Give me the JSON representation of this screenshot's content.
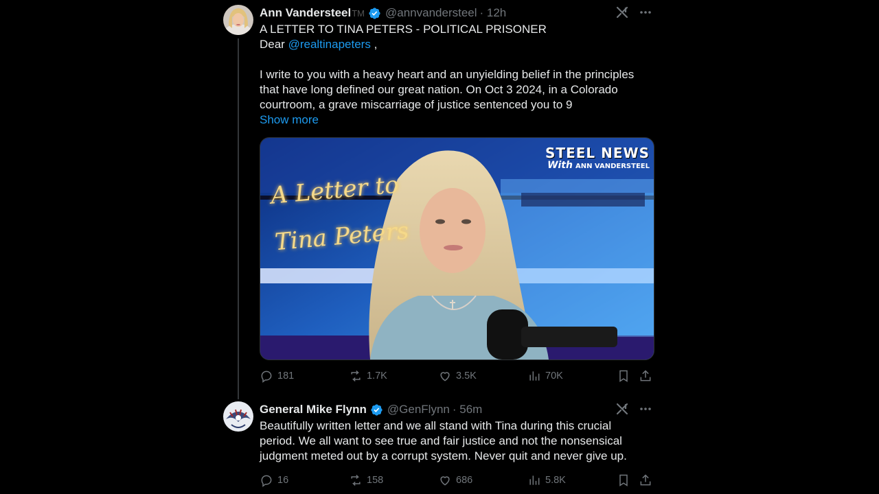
{
  "tweets": [
    {
      "author": {
        "name": "Ann Vandersteel",
        "tm": "TM",
        "handle": "@annvandersteel",
        "time": "· 12h",
        "verified": true
      },
      "title_line": "A LETTER TO TINA PETERS - POLITICAL PRISONER",
      "dear_prefix": "Dear ",
      "mention": "@realtinapeters",
      "dear_suffix": " ,",
      "body_lines": [
        "I write to you with a heavy heart and an unyielding belief in the principles",
        "that have long defined our great nation. On Oct 3 2024, in a Colorado",
        "courtroom, a grave miscarriage of justice sentenced you to 9"
      ],
      "show_more": "Show more",
      "media": {
        "overlay_line1": "A Letter to",
        "overlay_line2": "Tina Peters",
        "logo_line1": "STEEL NEWS",
        "logo_with": "With",
        "logo_line2": "ANN VANDERSTEEL"
      },
      "stats": {
        "replies": "181",
        "reposts": "1.7K",
        "likes": "3.5K",
        "views": "70K"
      }
    },
    {
      "author": {
        "name": "General Mike Flynn",
        "handle": "@GenFlynn",
        "time": "· 56m",
        "verified": true
      },
      "body_lines": [
        "Beautifully written letter and we all stand with Tina during this crucial",
        "period. We all want to see true and fair justice and not the nonsensical",
        "judgment meted out by a corrupt system. Never quit and never give up."
      ],
      "stats": {
        "replies": "16",
        "reposts": "158",
        "likes": "686",
        "views": "5.8K"
      }
    }
  ],
  "icons": [
    "grok-icon",
    "more-icon",
    "reply-icon",
    "repost-icon",
    "like-icon",
    "views-icon",
    "bookmark-icon",
    "share-icon",
    "verified-badge-icon"
  ],
  "colors": {
    "link": "#1d9bf0",
    "muted": "#71767b",
    "text": "#e7e9ea",
    "background": "#000000"
  }
}
